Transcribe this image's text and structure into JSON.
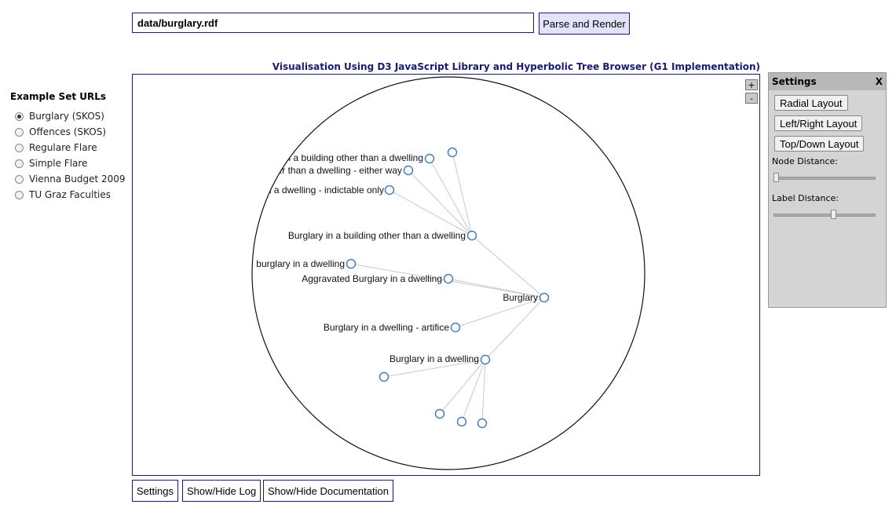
{
  "url_input": {
    "value": "data/burglary.rdf"
  },
  "parse_button": {
    "label": "Parse and Render"
  },
  "examples": {
    "heading": "Example Set URLs",
    "items": [
      {
        "label": "Burglary (SKOS)",
        "selected": true
      },
      {
        "label": "Offences (SKOS)",
        "selected": false
      },
      {
        "label": "Regulare Flare",
        "selected": false
      },
      {
        "label": "Simple Flare",
        "selected": false
      },
      {
        "label": "Vienna Budget 2009",
        "selected": false
      },
      {
        "label": "TU Graz Faculties",
        "selected": false
      }
    ]
  },
  "visualisation": {
    "title": "Visualisation Using D3 JavaScript Library and Hyperbolic Tree Browser (G1 Implementation)",
    "zoom_in": "+",
    "zoom_out": "-",
    "nodes": [
      {
        "label": "Burglary"
      },
      {
        "label": "Burglary in a building other than a dwelling"
      },
      {
        "label": "Aggravated Burglary in a dwelling"
      },
      {
        "label": "Burglary in a dwelling - artifice"
      },
      {
        "label": "Burglary in a dwelling"
      },
      {
        "label": "burglary in a dwelling"
      },
      {
        "label": "glary in a building other than a dwelling"
      },
      {
        "label": "other than a dwelling - either way"
      },
      {
        "label": "an a dwelling - indictable only"
      }
    ]
  },
  "settings": {
    "title": "Settings",
    "close": "X",
    "buttons": [
      "Radial Layout",
      "Left/Right Layout",
      "Top/Down Layout"
    ],
    "node_distance": {
      "label": "Node Distance:",
      "value": 0.0
    },
    "label_distance": {
      "label": "Label Distance:",
      "value": 0.6
    }
  },
  "bottom_buttons": {
    "settings": "Settings",
    "log": "Show/Hide Log",
    "docs": "Show/Hide Documentation"
  }
}
